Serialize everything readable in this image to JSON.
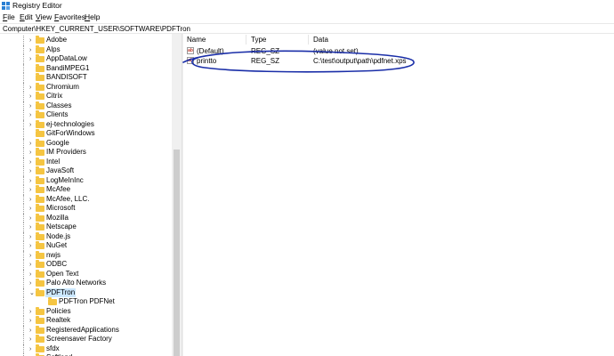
{
  "window": {
    "title": "Registry Editor"
  },
  "menu": [
    {
      "label": "File",
      "key": "F",
      "rest": "ile"
    },
    {
      "label": "Edit",
      "key": "E",
      "rest": "dit"
    },
    {
      "label": "View",
      "key": "V",
      "rest": "iew"
    },
    {
      "label": "Favorites",
      "key": "F",
      "rest": "avorites"
    },
    {
      "label": "Help",
      "key": "H",
      "rest": "elp"
    }
  ],
  "address": "Computer\\HKEY_CURRENT_USER\\SOFTWARE\\PDFTron",
  "tree": {
    "items": [
      {
        "label": "Adobe",
        "expandable": true
      },
      {
        "label": "Alps",
        "expandable": true
      },
      {
        "label": "AppDataLow",
        "expandable": true
      },
      {
        "label": "BandiMPEG1",
        "expandable": false
      },
      {
        "label": "BANDISOFT",
        "expandable": false
      },
      {
        "label": "Chromium",
        "expandable": true
      },
      {
        "label": "Citrix",
        "expandable": true
      },
      {
        "label": "Classes",
        "expandable": true
      },
      {
        "label": "Clients",
        "expandable": true
      },
      {
        "label": "ej-technologies",
        "expandable": true
      },
      {
        "label": "GitForWindows",
        "expandable": false
      },
      {
        "label": "Google",
        "expandable": true
      },
      {
        "label": "IM Providers",
        "expandable": true
      },
      {
        "label": "Intel",
        "expandable": true
      },
      {
        "label": "JavaSoft",
        "expandable": true
      },
      {
        "label": "LogMeInInc",
        "expandable": true
      },
      {
        "label": "McAfee",
        "expandable": true
      },
      {
        "label": "McAfee, LLC.",
        "expandable": true
      },
      {
        "label": "Microsoft",
        "expandable": true
      },
      {
        "label": "Mozilla",
        "expandable": true
      },
      {
        "label": "Netscape",
        "expandable": true
      },
      {
        "label": "Node.js",
        "expandable": true
      },
      {
        "label": "NuGet",
        "expandable": true
      },
      {
        "label": "nwjs",
        "expandable": true
      },
      {
        "label": "ODBC",
        "expandable": true
      },
      {
        "label": "Open Text",
        "expandable": true
      },
      {
        "label": "Palo Alto Networks",
        "expandable": true
      },
      {
        "label": "PDFTron",
        "expandable": true,
        "expanded": true,
        "selected": true
      },
      {
        "label": "PDFTron PDFNet",
        "expandable": false,
        "child": true
      },
      {
        "label": "Policies",
        "expandable": true
      },
      {
        "label": "Realtek",
        "expandable": true
      },
      {
        "label": "RegisteredApplications",
        "expandable": true
      },
      {
        "label": "Screensaver Factory",
        "expandable": true
      },
      {
        "label": "sfdx",
        "expandable": true
      },
      {
        "label": "Softland",
        "expandable": true
      }
    ]
  },
  "list": {
    "columns": {
      "name": "Name",
      "type": "Type",
      "data": "Data"
    },
    "rows": [
      {
        "name": "(Default)",
        "type": "REG_SZ",
        "data": "(value not set)"
      },
      {
        "name": "printto",
        "type": "REG_SZ",
        "data": "C:\\test\\output\\path\\pdfnet.xps"
      }
    ]
  },
  "colors": {
    "folder": "#f5c542",
    "selection": "#cce8ff",
    "annotation": "#1a2ea8"
  }
}
